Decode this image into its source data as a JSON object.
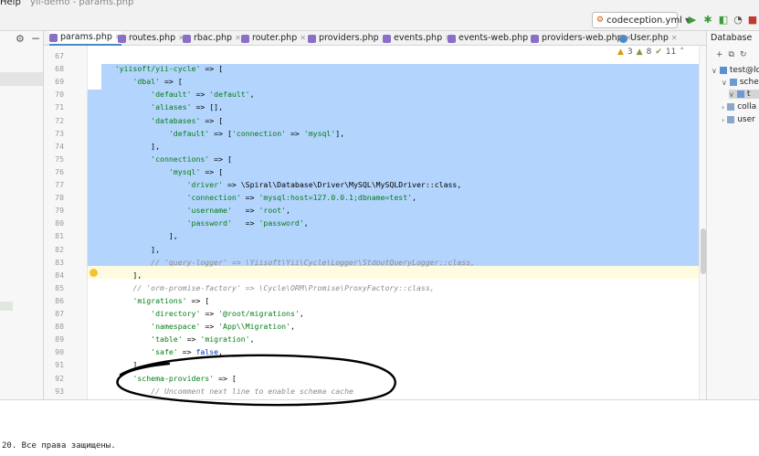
{
  "titlebar": {
    "menu": "Help",
    "title": "yii-demo - params.php"
  },
  "toolbar": {
    "run_config": "codeception.yml"
  },
  "tabs": [
    {
      "label": "params.php",
      "color": "#8a6fc7",
      "active": true
    },
    {
      "label": "routes.php",
      "color": "#8a6fc7"
    },
    {
      "label": "rbac.php",
      "color": "#8a6fc7"
    },
    {
      "label": "router.php",
      "color": "#8a6fc7"
    },
    {
      "label": "providers.php",
      "color": "#8a6fc7"
    },
    {
      "label": "events.php",
      "color": "#8a6fc7"
    },
    {
      "label": "events-web.php",
      "color": "#8a6fc7"
    },
    {
      "label": "providers-web.php",
      "color": "#8a6fc7"
    },
    {
      "label": "User.php",
      "color": "#4a88c7"
    }
  ],
  "editor_status": {
    "warnings": "3",
    "weak": "8",
    "typos": "11"
  },
  "code": {
    "lines": [
      {
        "n": "67",
        "t": ""
      },
      {
        "n": "68",
        "t": "    'yiisoft/yii-cycle' => ["
      },
      {
        "n": "69",
        "t": "        'dbal' => ["
      },
      {
        "n": "70",
        "t": "            'default' => 'default',"
      },
      {
        "n": "71",
        "t": "            'aliases' => [],"
      },
      {
        "n": "72",
        "t": "            'databases' => ["
      },
      {
        "n": "73",
        "t": "                'default' => ['connection' => 'mysql'],"
      },
      {
        "n": "74",
        "t": "            ],"
      },
      {
        "n": "75",
        "t": "            'connections' => ["
      },
      {
        "n": "76",
        "t": "                'mysql' => ["
      },
      {
        "n": "77",
        "t": "                    'driver' => \\Spiral\\Database\\Driver\\MySQL\\MySQLDriver::class,"
      },
      {
        "n": "78",
        "t": "                    'connection' => 'mysql:host=127.0.0.1;dbname=test',"
      },
      {
        "n": "79",
        "t": "                    'username'   => 'root',"
      },
      {
        "n": "80",
        "t": "                    'password'   => 'password',"
      },
      {
        "n": "81",
        "t": "                ],"
      },
      {
        "n": "82",
        "t": "            ],"
      },
      {
        "n": "83",
        "t": "            // 'query-logger' => \\Yiisoft\\Yii\\Cycle\\Logger\\StdoutQueryLogger::class,"
      },
      {
        "n": "84",
        "t": "        ],"
      },
      {
        "n": "85",
        "t": "        // 'orm-promise-factory' => \\Cycle\\ORM\\Promise\\ProxyFactory::class,"
      },
      {
        "n": "86",
        "t": "        'migrations' => ["
      },
      {
        "n": "87",
        "t": "            'directory' => '@root/migrations',"
      },
      {
        "n": "88",
        "t": "            'namespace' => 'App\\\\Migration',"
      },
      {
        "n": "89",
        "t": "            'table' => 'migration',"
      },
      {
        "n": "90",
        "t": "            'safe' => false,"
      },
      {
        "n": "91",
        "t": "        ],"
      },
      {
        "n": "92",
        "t": "        'schema-providers' => ["
      },
      {
        "n": "93",
        "t": "            // Uncomment next line to enable schema cache"
      }
    ]
  },
  "database": {
    "title": "Database",
    "tree": [
      {
        "label": "test@lo",
        "arrow": "∨"
      },
      {
        "label": "sche",
        "arrow": "∨"
      },
      {
        "label": "t",
        "arrow": "∨"
      },
      {
        "label": "colla",
        "arrow": "›"
      },
      {
        "label": "user",
        "arrow": "›"
      }
    ]
  },
  "footer": {
    "text": "20. Все права защищены."
  }
}
